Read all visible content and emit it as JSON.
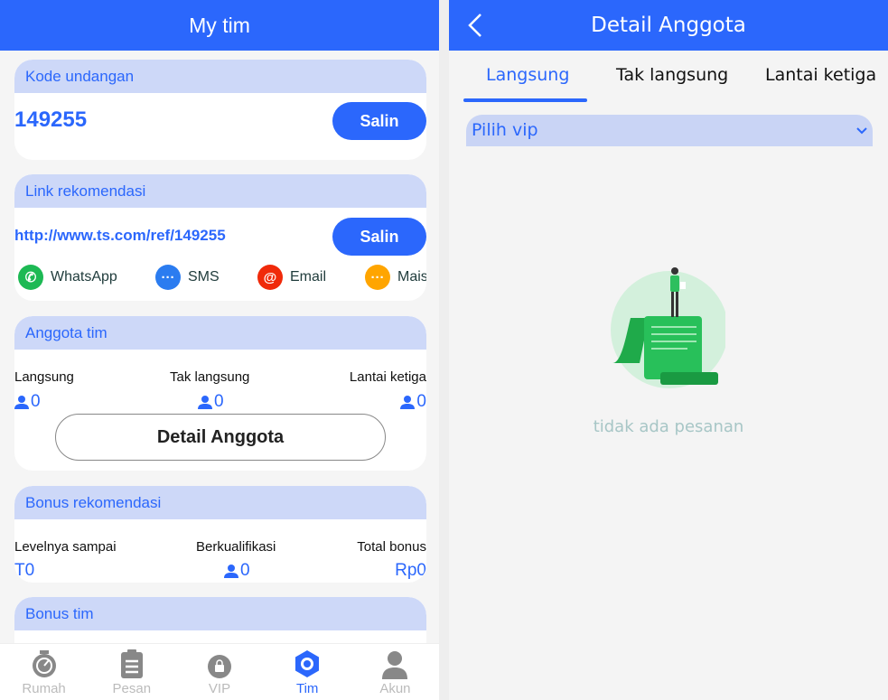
{
  "left": {
    "title": "My tim",
    "invite": {
      "header": "Kode undangan",
      "code": "149255",
      "copy_label": "Salin"
    },
    "link": {
      "header": "Link rekomendasi",
      "url": "http://www.ts.com/ref/149255",
      "copy_label": "Salin",
      "share": [
        {
          "label": "WhatsApp",
          "icon": "whatsapp-icon",
          "color": "#1db954"
        },
        {
          "label": "SMS",
          "icon": "sms-icon",
          "color": "#2b7cf0"
        },
        {
          "label": "Email",
          "icon": "email-icon",
          "color": "#f02a0a"
        },
        {
          "label": "Mais",
          "icon": "more-icon",
          "color": "#ffa500"
        }
      ]
    },
    "team": {
      "header": "Anggota tim",
      "cols": [
        {
          "label": "Langsung",
          "value": "0"
        },
        {
          "label": "Tak langsung",
          "value": "0"
        },
        {
          "label": "Lantai ketiga",
          "value": "0"
        }
      ],
      "detail_label": "Detail Anggota"
    },
    "bonus_ref": {
      "header": "Bonus rekomendasi",
      "cols": [
        {
          "label": "Levelnya sampai",
          "value": "T0"
        },
        {
          "label": "Berkualifikasi",
          "value": "0"
        },
        {
          "label": "Total bonus",
          "value": "Rp0"
        }
      ]
    },
    "bonus_team": {
      "header": "Bonus tim"
    },
    "nav": [
      {
        "label": "Rumah",
        "icon": "stopwatch-icon"
      },
      {
        "label": "Pesan",
        "icon": "clipboard-icon"
      },
      {
        "label": "VIP",
        "icon": "shopping-bag-icon"
      },
      {
        "label": "Tim",
        "icon": "team-gear-icon",
        "active": true
      },
      {
        "label": "Akun",
        "icon": "user-icon"
      }
    ],
    "accent": "#2b67fc"
  },
  "right": {
    "title": "Detail Anggota",
    "tabs": [
      {
        "label": "Langsung",
        "active": true
      },
      {
        "label": "Tak langsung"
      },
      {
        "label": "Lantai ketiga"
      }
    ],
    "select": {
      "value": "Pilih vip"
    },
    "empty_text": "tidak ada pesanan"
  }
}
